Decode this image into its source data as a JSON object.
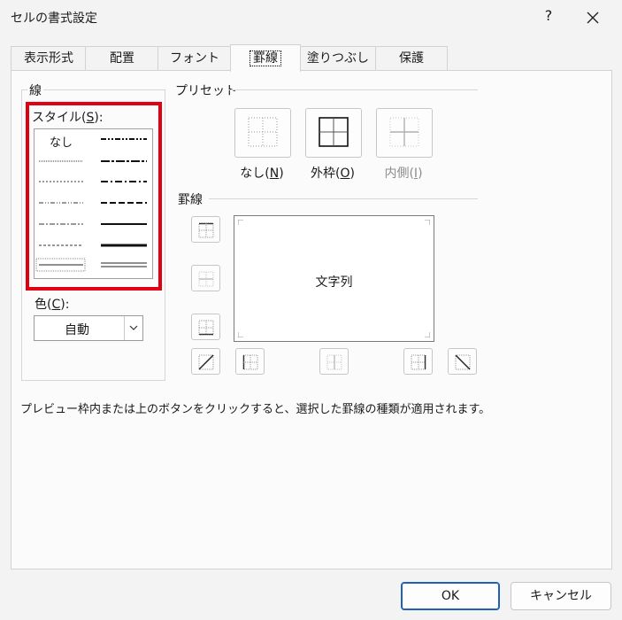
{
  "window": {
    "title": "セルの書式設定",
    "help": "?",
    "close_icon": "close-icon"
  },
  "tabs": [
    {
      "label": "表示形式",
      "active": false
    },
    {
      "label": "配置",
      "active": false
    },
    {
      "label": "フォント",
      "active": false
    },
    {
      "label": "罫線",
      "active": true
    },
    {
      "label": "塗りつぶし",
      "active": false
    },
    {
      "label": "保護",
      "active": false
    }
  ],
  "line": {
    "group_label": "線",
    "style_label_prefix": "スタイル(",
    "style_label_key": "S",
    "style_label_suffix": "):",
    "none_label": "なし",
    "color_label_prefix": "色(",
    "color_label_key": "C",
    "color_label_suffix": "):",
    "color_value": "自動",
    "highlight_color": "#e00012"
  },
  "presets": {
    "group_label": "プリセット",
    "items": [
      {
        "prefix": "なし(",
        "key": "N",
        "suffix": ")",
        "enabled": true
      },
      {
        "prefix": "外枠(",
        "key": "O",
        "suffix": ")",
        "enabled": true
      },
      {
        "prefix": "内側(",
        "key": "I",
        "suffix": ")",
        "enabled": false
      }
    ]
  },
  "border": {
    "group_label": "罫線",
    "preview_text": "文字列"
  },
  "description": "プレビュー枠内または上のボタンをクリックすると、選択した罫線の種類が適用されます。",
  "footer": {
    "ok_label": "OK",
    "cancel_label": "キャンセル"
  }
}
